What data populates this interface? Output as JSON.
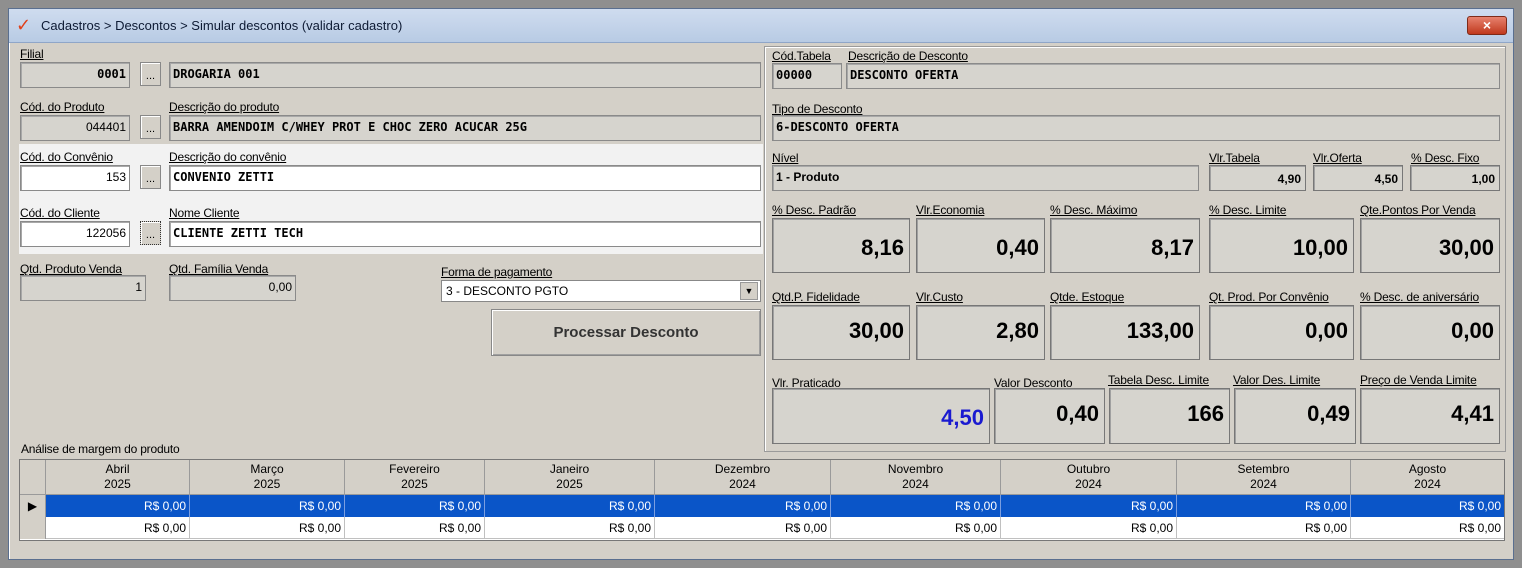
{
  "title": "Cadastros > Descontos > Simular descontos (validar cadastro)",
  "close_icon": "×",
  "left": {
    "filial": {
      "label": "Filial",
      "code": "0001",
      "desc": "DROGARIA 001"
    },
    "produto": {
      "code_label": "Cód. do Produto",
      "desc_label": "Descrição  do produto",
      "code": "044401",
      "desc": "BARRA AMENDOIM C/WHEY PROT E CHOC ZERO ACUCAR 25G"
    },
    "convenio": {
      "code_label": "Cód. do Convênio",
      "desc_label": "Descrição  do convênio",
      "code": "153",
      "desc": "CONVENIO ZETTI"
    },
    "cliente": {
      "code_label": "Cód. do Cliente",
      "desc_label": "Nome Cliente",
      "code": "122056",
      "desc": "CLIENTE ZETTI TECH"
    },
    "ellipsis": "...",
    "qtd_produto_label": "Qtd. Produto Venda",
    "qtd_produto": "1",
    "qtd_familia_label": "Qtd. Família Venda",
    "qtd_familia": "0,00",
    "pagamento_label": "Forma de pagamento",
    "pagamento_value": "3 - DESCONTO PGTO",
    "dropdown_icon": "▼",
    "process_button": "Processar Desconto"
  },
  "right": {
    "cod_tabela_label": "Cód.Tabela",
    "cod_tabela": "00000",
    "desc_desconto_label": "Descrição de Desconto",
    "desc_desconto": "DESCONTO OFERTA",
    "tipo_label": "Tipo de Desconto",
    "tipo": "6-DESCONTO OFERTA",
    "nivel_label": "Nível",
    "nivel": "1 - Produto",
    "vl_tabela_label": "Vlr.Tabela",
    "vl_tabela": "4,90",
    "vl_oferta_label": "Vlr.Oferta",
    "vl_oferta": "4,50",
    "desc_fixo_label": "% Desc. Fixo",
    "desc_fixo": "1,00",
    "row1": [
      {
        "label": "% Desc. Padrão",
        "value": "8,16"
      },
      {
        "label": "Vlr.Economia",
        "value": "0,40"
      },
      {
        "label": "% Desc. Máximo",
        "value": "8,17"
      },
      {
        "label": "% Desc. Limite",
        "value": "10,00"
      },
      {
        "label": "Qte.Pontos Por Venda",
        "value": "30,00"
      }
    ],
    "row2": [
      {
        "label": "Qtd.P. Fidelidade",
        "value": "30,00"
      },
      {
        "label": "Vlr.Custo",
        "value": "2,80"
      },
      {
        "label": "Qtde. Estoque",
        "value": "133,00"
      },
      {
        "label": "Qt. Prod. Por Convênio",
        "value": "0,00"
      },
      {
        "label": "% Desc. de aniversário",
        "value": "0,00"
      }
    ],
    "row3": [
      {
        "label": "Vlr. Praticado",
        "value": "4,50"
      },
      {
        "label": "Valor Desconto",
        "value": "0,40"
      },
      {
        "label": "Tabela Desc. Limite",
        "value": "166"
      },
      {
        "label": "Valor Des. Limite",
        "value": "0,49"
      },
      {
        "label": "Preço de Venda Limite",
        "value": "4,41"
      }
    ]
  },
  "grid": {
    "title": "Análise de margem do produto",
    "row_marker": "▶",
    "columns": [
      {
        "month": "Abril",
        "year": "2025"
      },
      {
        "month": "Março",
        "year": "2025"
      },
      {
        "month": "Fevereiro",
        "year": "2025"
      },
      {
        "month": "Janeiro",
        "year": "2025"
      },
      {
        "month": "Dezembro",
        "year": "2024"
      },
      {
        "month": "Novembro",
        "year": "2024"
      },
      {
        "month": "Outubro",
        "year": "2024"
      },
      {
        "month": "Setembro",
        "year": "2024"
      },
      {
        "month": "Agosto",
        "year": "2024"
      }
    ],
    "rows": [
      [
        "R$ 0,00",
        "R$ 0,00",
        "R$ 0,00",
        "R$ 0,00",
        "R$ 0,00",
        "R$ 0,00",
        "R$ 0,00",
        "R$ 0,00",
        "R$ 0,00"
      ],
      [
        "R$ 0,00",
        "R$ 0,00",
        "R$ 0,00",
        "R$ 0,00",
        "R$ 0,00",
        "R$ 0,00",
        "R$ 0,00",
        "R$ 0,00",
        "R$ 0,00"
      ]
    ]
  }
}
